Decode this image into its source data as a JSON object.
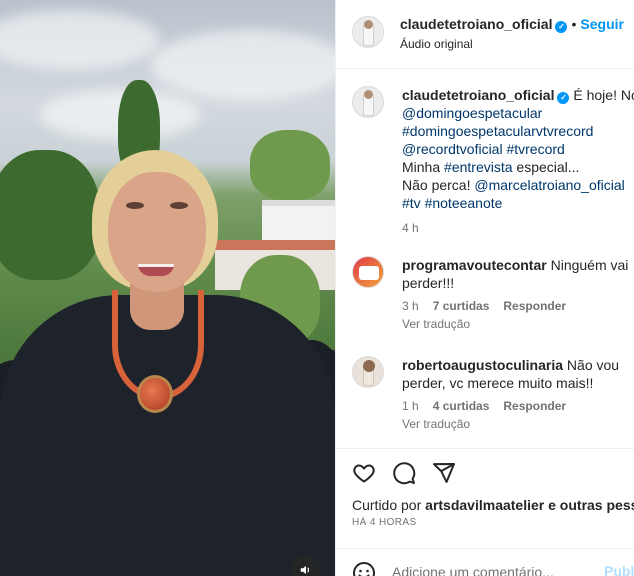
{
  "header": {
    "username": "claudetetroiano_oficial",
    "separator": "•",
    "follow_label": "Seguir",
    "subtitle": "Áudio original",
    "verified_mark": "✓"
  },
  "caption": {
    "username": "claudetetroiano_oficial",
    "line1": "É hoje! No",
    "line2": "@domingoespetacular",
    "line3": "#domingoespetacularvtvrecord",
    "line4": "@recordtvoficial #tvrecord",
    "line5_prefix": "Minha ",
    "line5_tag": "#entrevista",
    "line5_suffix": " especial...",
    "line6_prefix": "Não perca! ",
    "line6_tag": "@marcelatroiano_oficial",
    "line7": "#tv #noteeanote",
    "time": "4 h"
  },
  "comments": [
    {
      "username": "programavoutecontar",
      "text": "Ninguém vai perder!!!",
      "time": "3 h",
      "likes": "7 curtidas",
      "reply_label": "Responder",
      "translate_label": "Ver tradução"
    },
    {
      "username": "robertoaugustoculinaria",
      "text": "Não vou perder, vc merece muito mais!!",
      "time": "1 h",
      "likes": "4 curtidas",
      "reply_label": "Responder",
      "translate_label": "Ver tradução"
    }
  ],
  "actions": {
    "icons": [
      "heart-icon",
      "comment-icon",
      "share-icon"
    ],
    "liked_prefix": "Curtido por ",
    "liked_user": "artsdavilmaatelier",
    "liked_suffix": " e outras pessoas",
    "time_ago": "HÁ 4 HORAS"
  },
  "add_comment": {
    "placeholder": "Adicione um comentário...",
    "publish_label": "Publicar"
  },
  "video": {
    "mute_icon": "speaker-icon"
  },
  "colors": {
    "accent": "#0095f6",
    "link": "#00376b",
    "secondary_text": "#737373"
  }
}
